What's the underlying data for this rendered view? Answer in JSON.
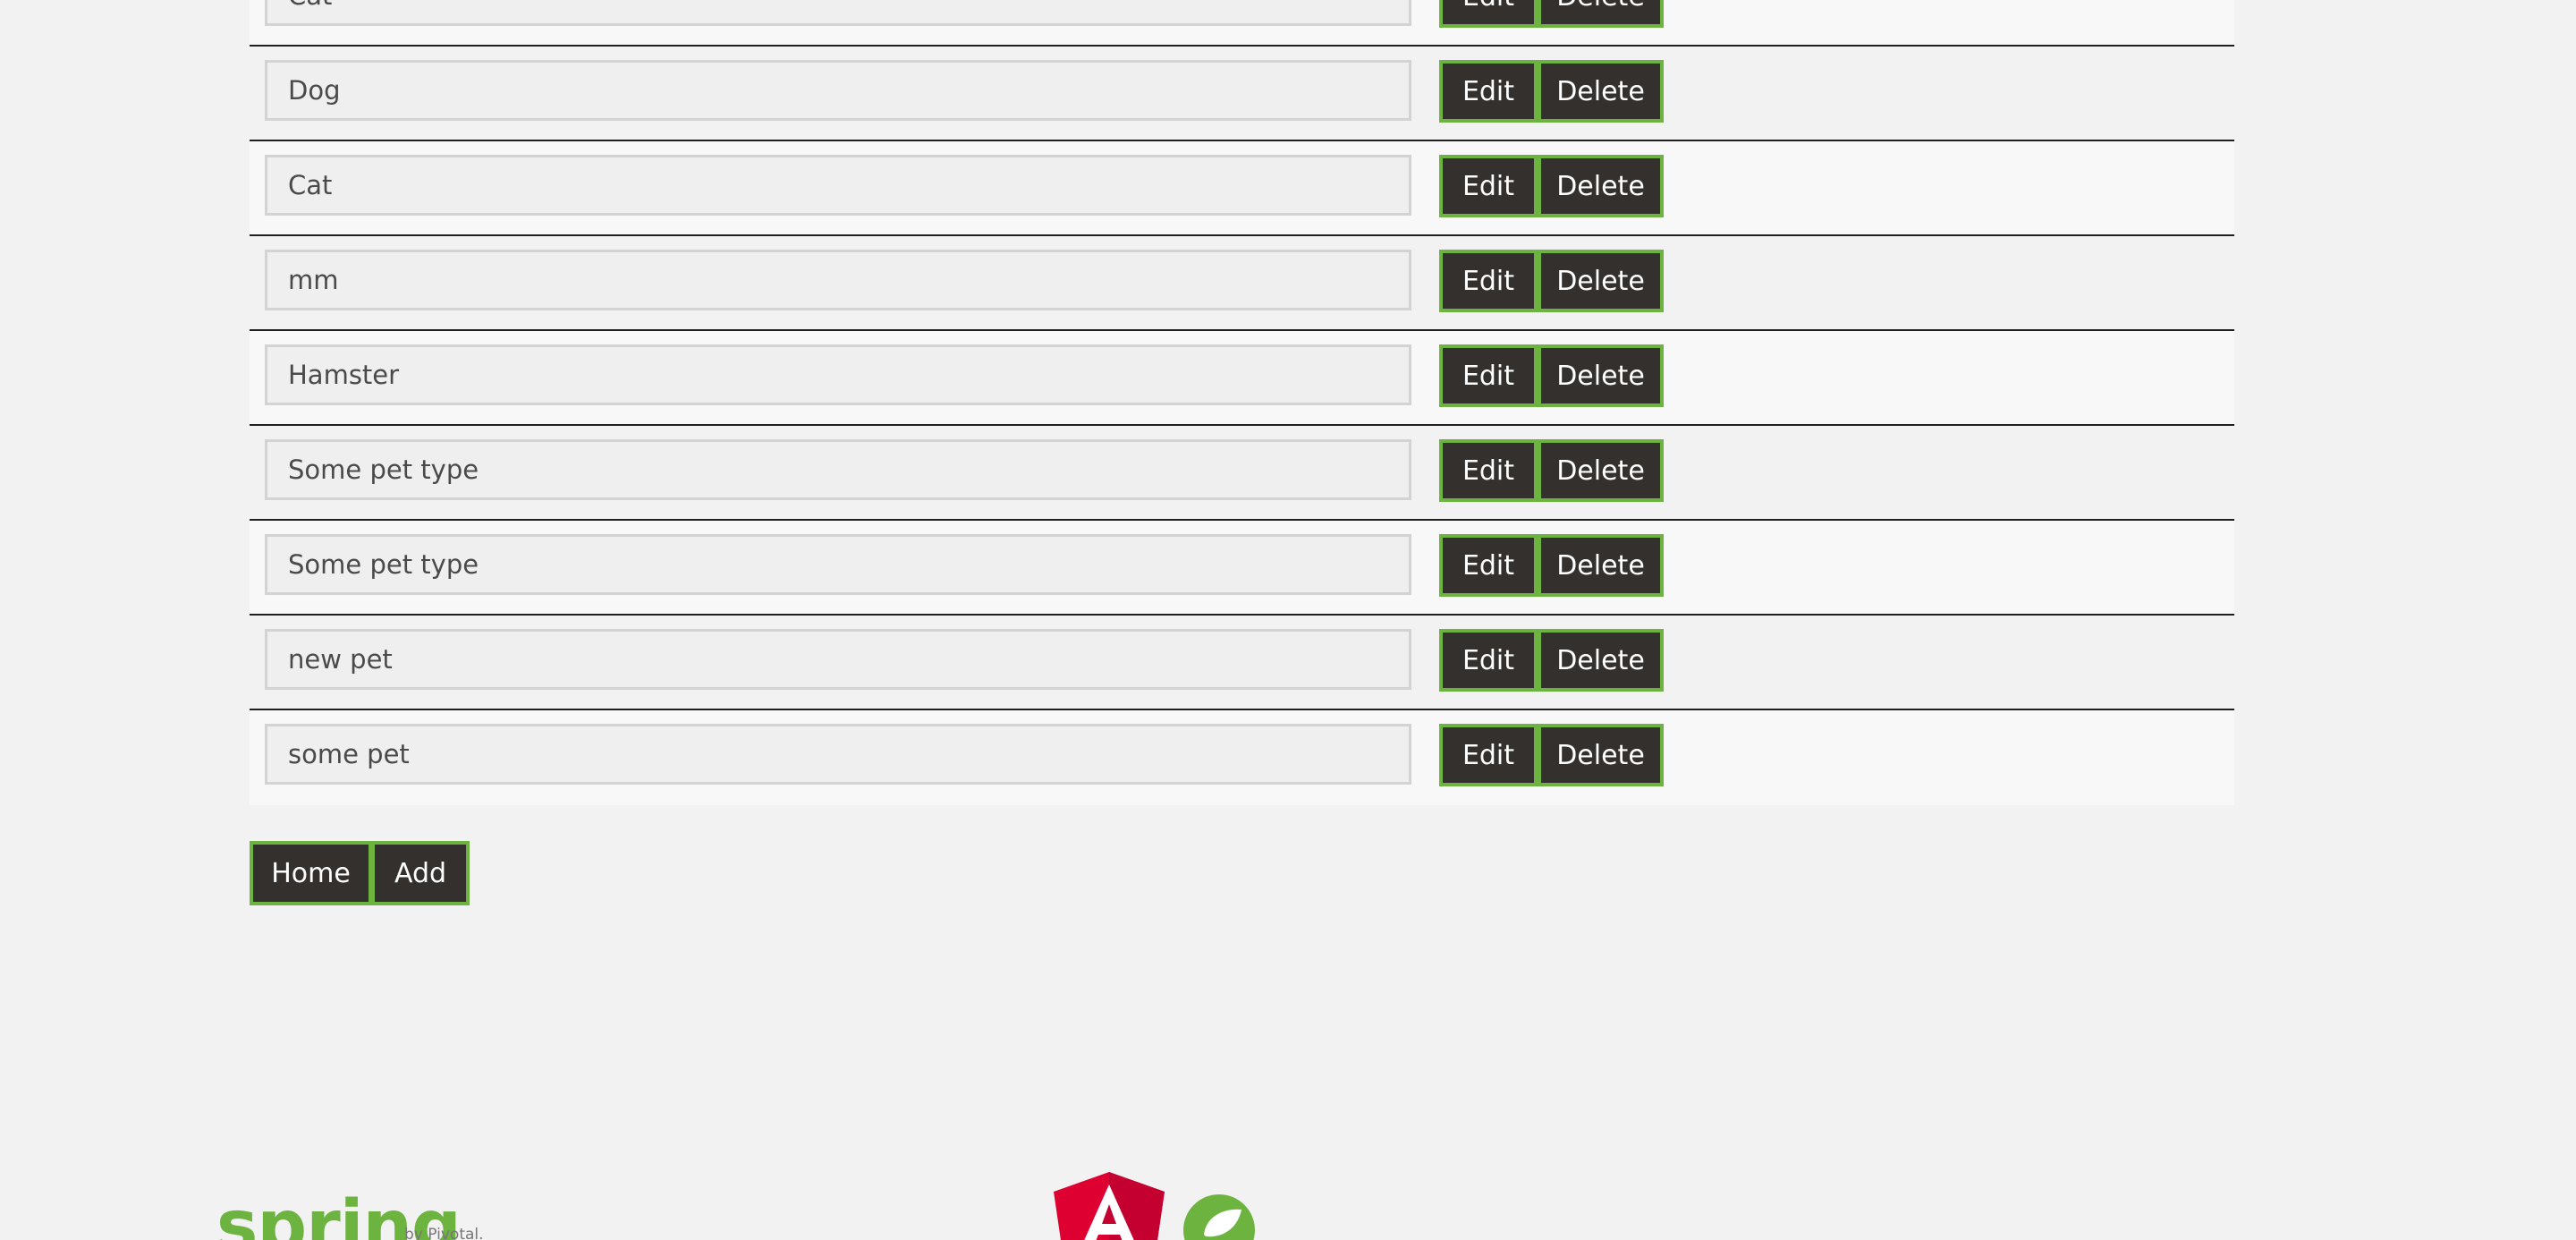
{
  "pet_types": [
    {
      "name": "Cat"
    },
    {
      "name": "Dog"
    },
    {
      "name": "Cat"
    },
    {
      "name": "mm"
    },
    {
      "name": "Hamster"
    },
    {
      "name": "Some pet type"
    },
    {
      "name": "Some pet type"
    },
    {
      "name": "new pet"
    },
    {
      "name": "some pet"
    }
  ],
  "row_actions": {
    "edit_label": "Edit",
    "delete_label": "Delete"
  },
  "footer_actions": {
    "home_label": "Home",
    "add_label": "Add"
  },
  "logos": {
    "spring_word": "spring",
    "spring_tagline": "by Pivotal."
  },
  "colors": {
    "background": "#f2f2f2",
    "button_bg": "#34302d",
    "button_border": "#6db33f",
    "angular_red": "#dd0031",
    "spring_green": "#6db33f"
  }
}
